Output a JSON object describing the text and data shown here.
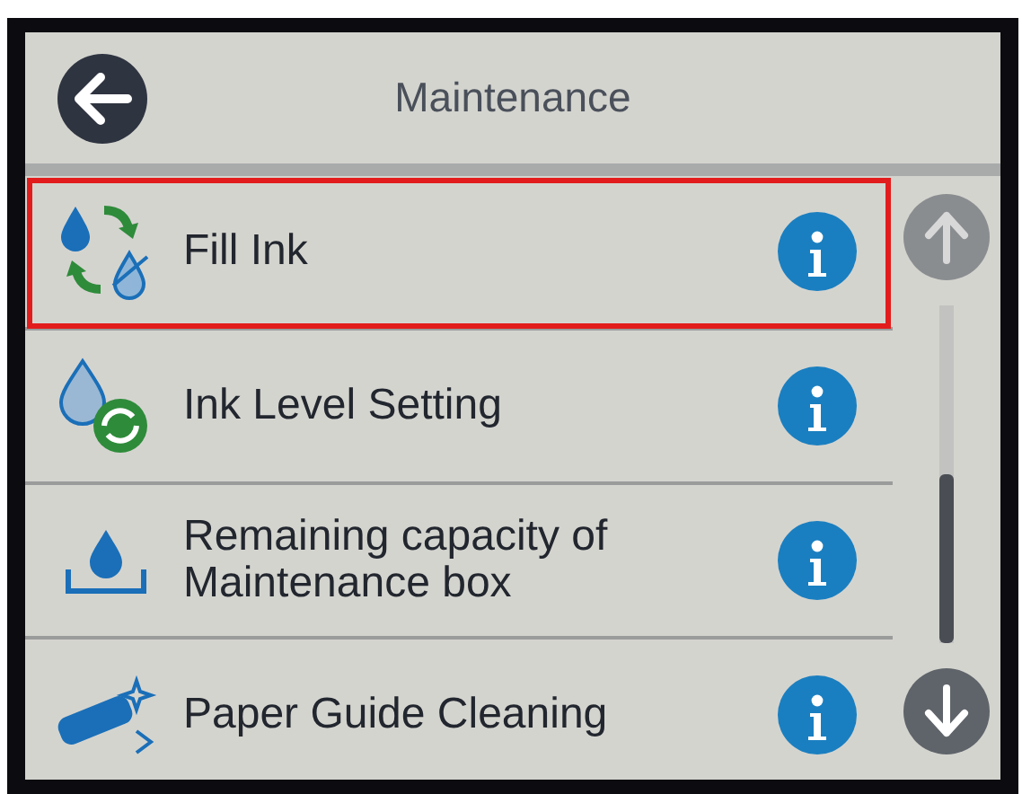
{
  "header": {
    "back_button": true,
    "title": "Maintenance"
  },
  "items": [
    {
      "label": "Fill Ink",
      "kind": "fill",
      "highlighted": true,
      "info": true
    },
    {
      "label": "Ink Level Setting",
      "kind": "level",
      "highlighted": false,
      "info": true
    },
    {
      "label": "Remaining capacity of Maintenance box",
      "kind": "waste",
      "highlighted": false,
      "info": true
    },
    {
      "label": "Paper Guide Cleaning",
      "kind": "cleaning",
      "highlighted": false,
      "info": true
    }
  ],
  "scroll": {
    "up_disabled": true,
    "down_disabled": false
  }
}
